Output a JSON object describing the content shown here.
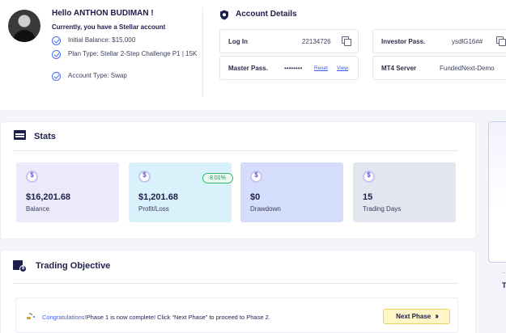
{
  "user": {
    "greeting": "Hello ANTHON BUDIMAN !",
    "subtitle": "Currently, you have a Stellar account",
    "details": [
      "Initial Balance: $15,000",
      "Plan Type: Stellar 2-Step Challenge P1 | 15K",
      "Account Type: Swap"
    ]
  },
  "account": {
    "title": "Account Details",
    "login_label": "Log In",
    "login_value": "22134726",
    "investor_label": "Investor Pass.",
    "investor_value": "ysdlG16##",
    "master_label": "Master Pass.",
    "master_value": "••••••••",
    "reset_label": "Reset",
    "view_label": "View",
    "server_label": "MT4 Server",
    "server_value": "FundedNext-Demo"
  },
  "stats": {
    "title": "Stats",
    "cards": [
      {
        "amount": "$16,201.68",
        "label": "Balance",
        "color": "#ece9fb"
      },
      {
        "amount": "$1,201.68",
        "label": "Profit/Loss",
        "badge": "8.01%",
        "color": "#d8f1fa"
      },
      {
        "amount": "$0",
        "label": "Drawdown",
        "color": "#d4ddfb"
      },
      {
        "amount": "15",
        "label": "Trading Days",
        "color": "#e1e6ef"
      }
    ]
  },
  "objective": {
    "title": "Trading Objective",
    "banner_highlight": "Congratulations!",
    "banner_text": "Phase 1 is now complete! Click “Next Phase” to proceed to Phase 2.",
    "next_button": "Next Phase"
  },
  "side": {
    "letter": "T",
    "dash": "--"
  },
  "colors": {
    "accent": "#3d5af1",
    "check": "#4a6cf7",
    "success": "#35b56b",
    "button_bg": "#fff5c7"
  },
  "icons": {
    "account": "shield-icon",
    "stats": "stats-icon",
    "objective": "calendar-dollar-icon",
    "copy": "copy-icon",
    "coin": "dollar-coin-icon",
    "check": "check-circle-icon",
    "party": "party-popper-icon",
    "next": "double-chevron-right-icon"
  }
}
